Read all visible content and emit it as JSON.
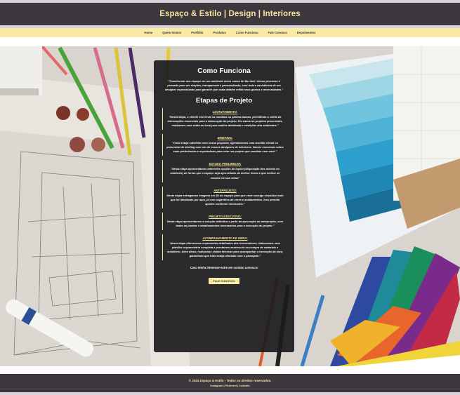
{
  "header": {
    "title": "Espaço & Estilo | Design | Interiores"
  },
  "nav": {
    "items": [
      "Home",
      "Quem Somos",
      "Portfólio",
      "Produtos",
      "Como Funciona",
      "Fale Conosco",
      "Depoimentos"
    ]
  },
  "panel": {
    "title": "Como Funciona",
    "intro": "\"Transformar seu espaço em um ambiente único nunca foi tão fácil. Nosso processo é pensado para ser simples, transparente e personalizado, com toda a assistência de um designer especializado para garantir que cada detalhe reflita seus gostos e necessidades.\"",
    "steps_title": "Etapas de Projeto",
    "steps": [
      {
        "title": "LEVANTAMENTO:",
        "text": "\"Nesta etapa, o cliente nos envia as medidas ou plantas baixas, permitindo a coleta de informações essenciais para a elaboração do projeto. Em casos de projetos presenciais, realizamos uma visita ao local para análise detalhada e medições dos ambientes.\""
      },
      {
        "title": "BRIEFING:",
        "text": "\"Caso esteja satisfeito com nossa proposta, agendaremos uma reunião virtual ou presencial de briefing com um de nossos designers de interiores. Vamos conversar sobre suas preferências e expectativas para criar um projeto que combine com você.\""
      },
      {
        "title": "ESTUDO PRELIMINAR:",
        "text": "\"Nesta etapa apresentamos diferentes opções de layout (disposição dos móveis no ambiente) de forma que o espaço seja aproveitado da melhor forma e que melhor se encaixe na sua rotina\""
      },
      {
        "title": "ANTEPROJETO:",
        "text": "Nesta etapa entregamos imagens em 3D do espaço para que você consiga visualizar tudo que foi idealizado por aqui, já com sugestões de cores e acabamentos. Isso permite ajustes conforme necessário.\""
      },
      {
        "title": "PROJETO EXECUTIVO:",
        "text": "Nesta etapa apresentamos a solução definitiva a partir da aprovação do anteprojeto, com todas as plantas e detalhamentos necessários para a execução do projeto.\""
      },
      {
        "title": "ACOMPANHAMENTO DE OBRA:",
        "text": "Nesta etapa oferecemos orçamentos detalhados dos fornecedores, elaboramos uma planilha orçamentária completa e prestamos assessoria na compra de materiais e mobiliário. Além disso, realizamos visitas técnicas para acompanhar a execução da obra, garantindo que tudo esteja alinhado com o planejado.\""
      }
    ],
    "cta_text": "Caso tenha interesse entre em contato conosco!",
    "cta_button": "FALE CONOSCO"
  },
  "footer": {
    "copyright": "© 2024 Espaço & Estilo - Todos os direitos reservados.",
    "social": "Instagram | Pinterest | LinkedIn"
  },
  "colors": {
    "dark": "#3d383d",
    "accent": "#f7eba5",
    "accent_text": "#f3e6a0"
  }
}
